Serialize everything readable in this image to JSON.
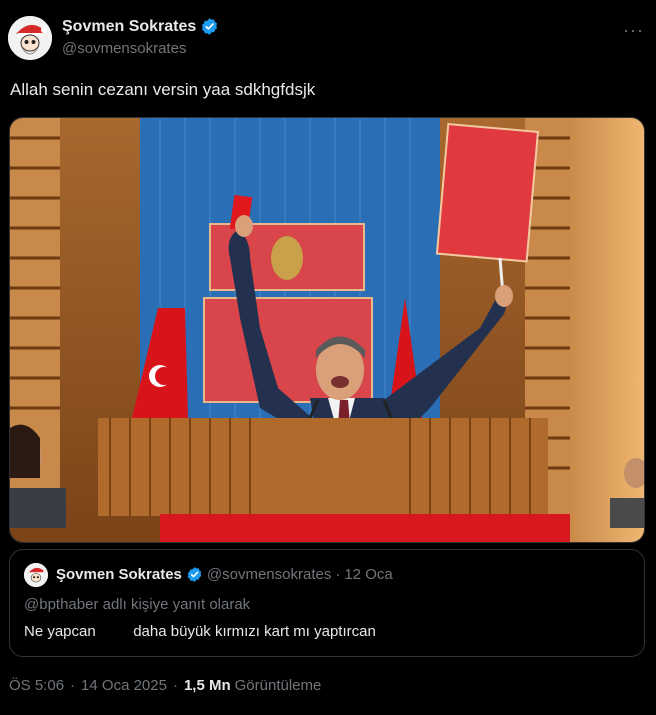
{
  "author": {
    "name": "Şovmen Sokrates",
    "handle": "@sovmensokrates",
    "avatar": "santa-hat-cartoon-avatar"
  },
  "more_menu": "···",
  "tweet": {
    "text": "Allah senin cezanı versin yaa sdkhgfdsjk"
  },
  "media": {
    "description_icon": "photo-of-politician-raising-red-cards-at-podium"
  },
  "quoted_tweet": {
    "name": "Şovmen Sokrates",
    "handle": "@sovmensokrates",
    "separator": "·",
    "date": "12 Oca",
    "reply_to": "@bpthaber adlı kişiye yanıt olarak",
    "text": "Ne yapcan         daha büyük kırmızı kart mı yaptırcan"
  },
  "meta": {
    "time": "ÖS 5:06",
    "separator": "·",
    "date": "14 Oca 2025",
    "views_count": "1,5 Mn",
    "views_label": "Görüntüleme"
  },
  "colors": {
    "background": "#000000",
    "primary_text": "#e7e9ea",
    "secondary_text": "#71767b",
    "verified": "#1d9bf0",
    "border": "#2f3336"
  }
}
